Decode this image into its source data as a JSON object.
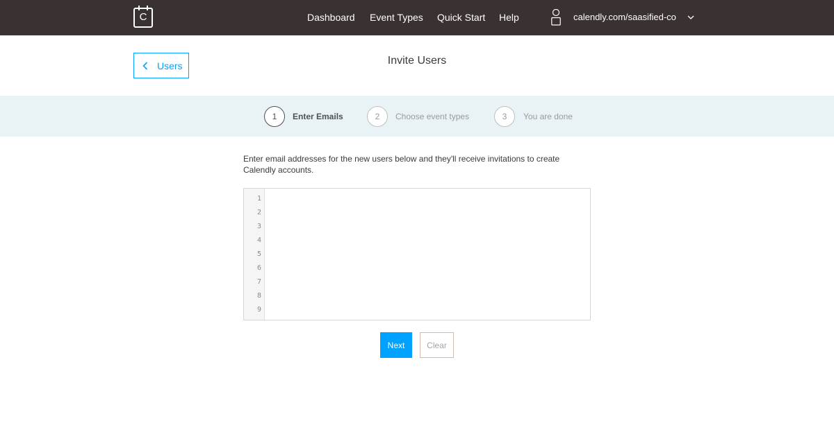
{
  "nav": {
    "logo_letter": "C",
    "links": [
      "Dashboard",
      "Event Types",
      "Quick Start",
      "Help"
    ],
    "user_url": "calendly.com/saasified-co",
    "icons": {
      "logo": "calendar-logo-icon",
      "user": "user-icon",
      "menu": "chevron-down-icon"
    }
  },
  "header": {
    "back_label": "Users",
    "title": "Invite Users"
  },
  "steps": [
    {
      "number": "1",
      "label": "Enter Emails",
      "active": true
    },
    {
      "number": "2",
      "label": "Choose event types",
      "active": false
    },
    {
      "number": "3",
      "label": "You are done",
      "active": false
    }
  ],
  "form": {
    "instructions": "Enter email addresses for the new users below and they'll receive invitations to create Calendly accounts.",
    "line_numbers": [
      "1",
      "2",
      "3",
      "4",
      "5",
      "6",
      "7",
      "8",
      "9"
    ],
    "email_value": "",
    "next_label": "Next",
    "clear_label": "Clear"
  },
  "colors": {
    "topbar": "#3a3132",
    "accent": "#00a2ff",
    "steps_band": "#e9f3f6"
  }
}
